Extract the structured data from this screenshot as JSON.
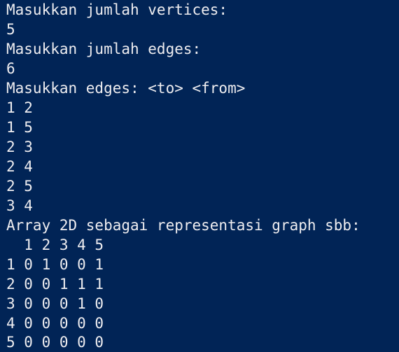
{
  "terminal": {
    "background_color": "#012456",
    "foreground_color": "#eeedf0",
    "lines": [
      "Masukkan jumlah vertices:",
      "5",
      "Masukkan jumlah edges:",
      "6",
      "Masukkan edges: <to> <from>",
      "1 2",
      "1 5",
      "2 3",
      "2 4",
      "2 5",
      "3 4",
      "Array 2D sebagai representasi graph sbb:",
      "  1 2 3 4 5",
      "1 0 1 0 0 1",
      "2 0 0 1 1 1",
      "3 0 0 0 1 0",
      "4 0 0 0 0 0",
      "5 0 0 0 0 0"
    ]
  }
}
